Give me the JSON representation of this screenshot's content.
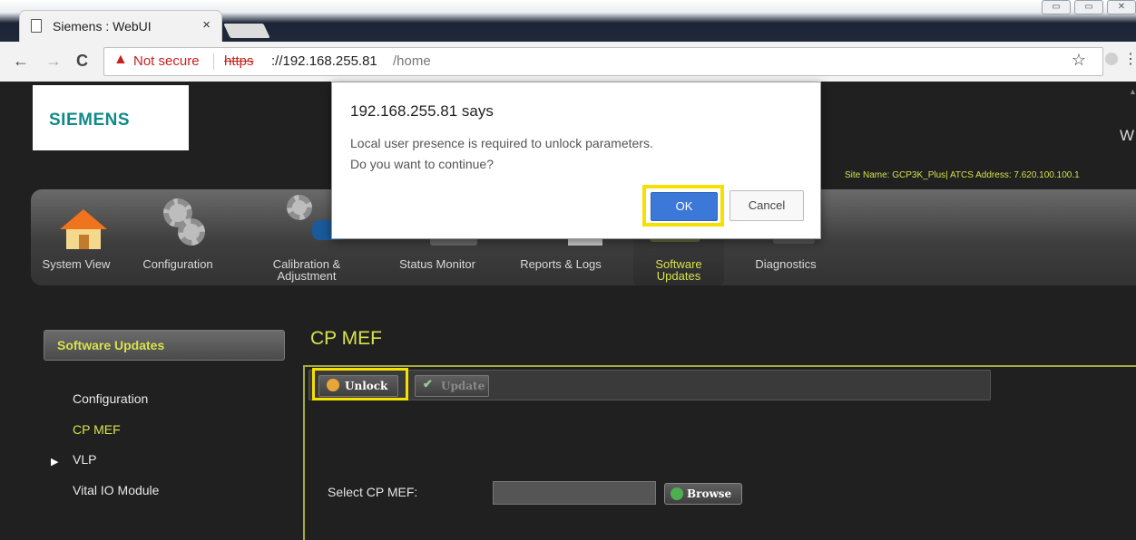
{
  "browser": {
    "tab_title": "Siemens : WebUI",
    "tab_close": "×",
    "security_label": "Not secure",
    "url_scheme": "https",
    "url_host": "://192.168.255.81",
    "url_path": "/home",
    "nav_back": "←",
    "nav_forward": "→",
    "reload": "C",
    "star": "☆",
    "menu": "⋮",
    "window_controls": [
      "▭",
      "▭",
      "✕"
    ]
  },
  "header": {
    "logo": "SIEMENS",
    "partial_text": "W",
    "site_info": "Site Name: GCP3K_Plus| ATCS Address: 7.620.100.100.1"
  },
  "nav": {
    "items": [
      {
        "label": "System View",
        "icon": "house-icon"
      },
      {
        "label": "Configuration",
        "icon": "gears-icon"
      },
      {
        "label": "Calibration & Adjustment",
        "icon": "calibration-icon"
      },
      {
        "label": "Status Monitor",
        "icon": "status-monitor-icon"
      },
      {
        "label": "Reports & Logs",
        "icon": "reports-icon"
      },
      {
        "label": "Software Updates",
        "icon": "software-updates-icon",
        "active": true
      },
      {
        "label": "Diagnostics",
        "icon": "diagnostics-icon"
      }
    ]
  },
  "sidebar": {
    "header": "Software Updates",
    "items": [
      {
        "label": "Configuration"
      },
      {
        "label": "CP MEF",
        "active": true
      },
      {
        "label": "VLP",
        "expandable": true
      },
      {
        "label": "Vital IO Module"
      }
    ],
    "expand_arrow": "▶"
  },
  "main": {
    "title": "CP MEF",
    "unlock_label": "Unlock",
    "update_label": "Update",
    "select_label": "Select CP MEF:",
    "browse_label": "Browse",
    "file_value": ""
  },
  "dialog": {
    "title": "192.168.255.81 says",
    "message_line1": "Local user presence is required to unlock parameters.",
    "message_line2": "Do you want to continue?",
    "ok_label": "OK",
    "cancel_label": "Cancel"
  },
  "colors": {
    "accent": "#d9e24a",
    "highlight": "#f5e000",
    "ok_button": "#3c78d8",
    "logo": "#0f8a8a",
    "insecure": "#c5221f"
  }
}
